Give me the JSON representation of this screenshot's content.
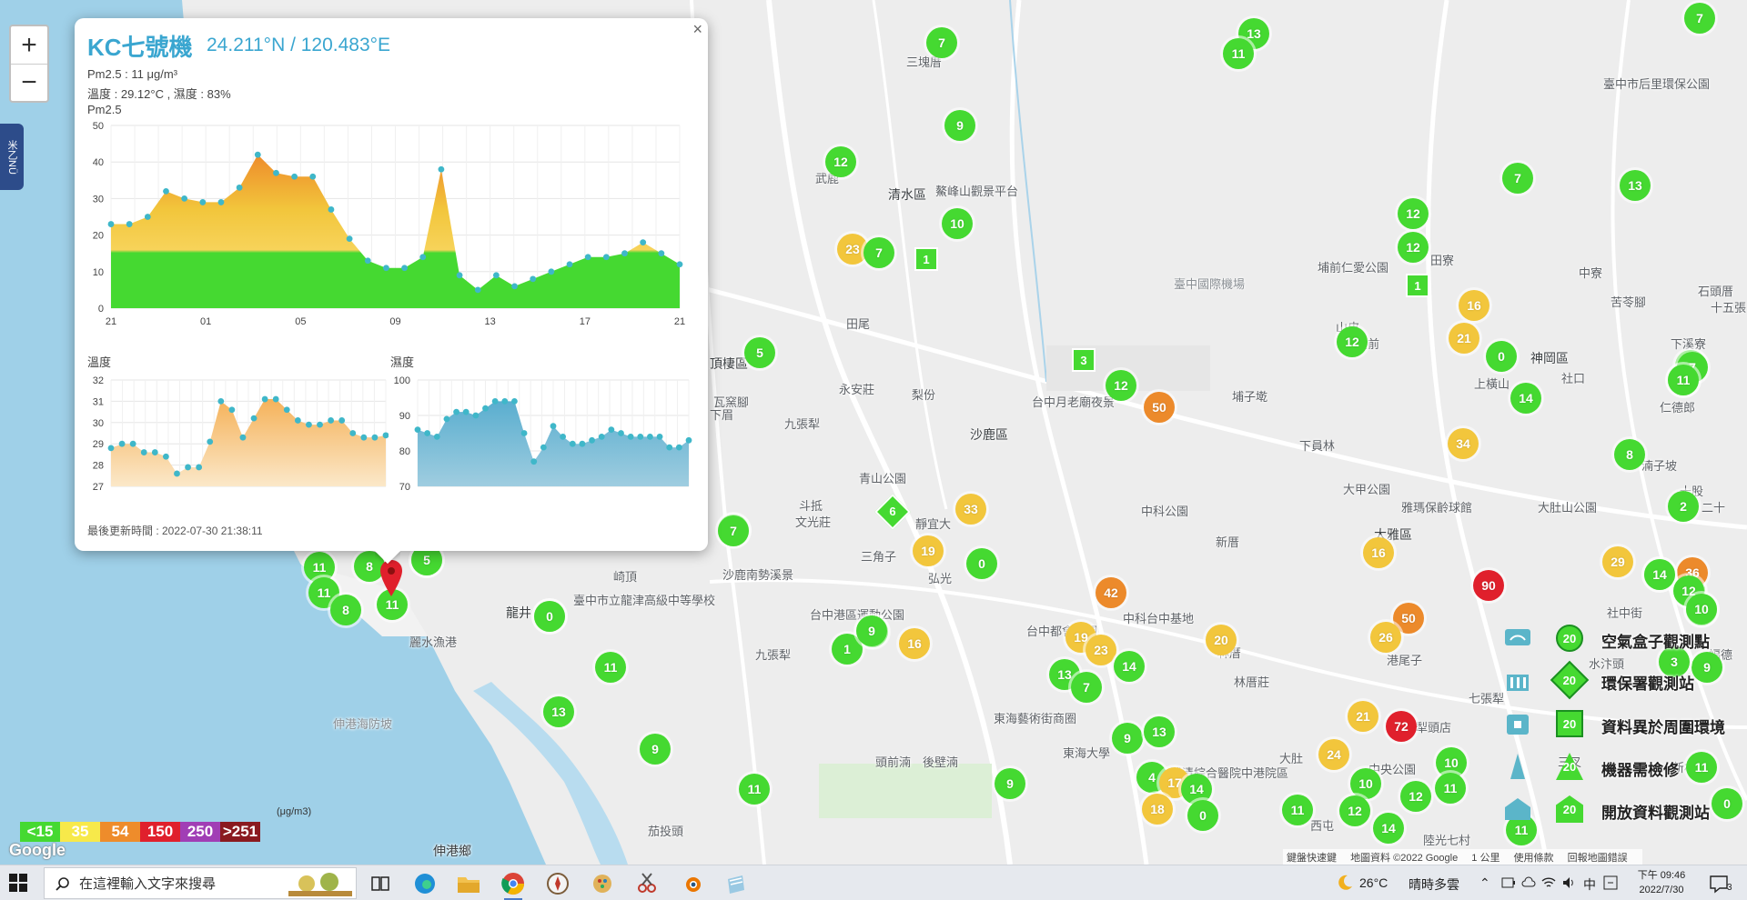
{
  "map": {
    "places": [
      "三塊厝",
      "臺中市后里環保公園",
      "武鹿",
      "清水區",
      "鰲峰山觀景平台",
      "臺中國際機場",
      "埔前仁愛公園",
      "田寮",
      "田尾",
      "山皮",
      "中寮",
      "苦苓腳",
      "石頭厝",
      "十五張",
      "莊前",
      "神岡區",
      "社口",
      "下溪寮",
      "永安莊",
      "梨份",
      "頂棲區",
      "沙鹿區",
      "台中月老廟夜景",
      "埔子墘",
      "下員林",
      "瓦窯腳",
      "下眉",
      "九張犁",
      "青山公園",
      "斗抵",
      "文光莊",
      "三角子",
      "靜宜大",
      "弘光",
      "大甲公園",
      "雅瑪保齡球館",
      "大肚山公園",
      "大雅區",
      "新厝",
      "中科公園",
      "湳子坡",
      "十股",
      "仁德郎",
      "二十",
      "上橫山",
      "崎頂",
      "臺中市立龍津高級中等學校",
      "龍井",
      "沙鹿南勢溪景",
      "台中港區運動公園",
      "中科台中基地",
      "林厝",
      "林厝莊",
      "港尾子",
      "麗水漁港",
      "台中都會公園",
      "九張犁",
      "東海藝術街商圈",
      "東海大學",
      "澄清綜合醫院中港院區",
      "中央公園",
      "西屯",
      "伸港海防坡",
      "伸港鄉",
      "茄投頭",
      "後壁湳",
      "頭前湳",
      "陸光七村",
      "大肚",
      "水汴頭",
      "七張犁",
      "犁頭店",
      "三叉",
      "社中街",
      "新村",
      "福德"
    ],
    "clusters": [
      {
        "v": "7",
        "c": "g"
      },
      {
        "v": "13",
        "c": "g"
      },
      {
        "v": "11",
        "c": "g"
      },
      {
        "v": "9",
        "c": "g"
      },
      {
        "v": "12",
        "c": "g"
      },
      {
        "v": "7",
        "c": "g"
      },
      {
        "v": "13",
        "c": "g"
      },
      {
        "v": "10",
        "c": "g"
      },
      {
        "v": "12",
        "c": "g"
      },
      {
        "v": "12",
        "c": "g"
      },
      {
        "v": "23",
        "c": "y"
      },
      {
        "v": "7",
        "c": "g"
      },
      {
        "v": "16",
        "c": "y"
      },
      {
        "v": "21",
        "c": "y"
      },
      {
        "v": "0",
        "c": "g"
      },
      {
        "v": "12",
        "c": "g"
      },
      {
        "v": "5",
        "c": "g"
      },
      {
        "v": "12",
        "c": "g"
      },
      {
        "v": "50",
        "c": "o"
      },
      {
        "v": "14",
        "c": "g"
      },
      {
        "v": "7",
        "c": "g"
      },
      {
        "v": "11",
        "c": "g"
      },
      {
        "v": "34",
        "c": "y"
      },
      {
        "v": "8",
        "c": "g"
      },
      {
        "v": "33",
        "c": "y"
      },
      {
        "v": "2",
        "c": "g"
      },
      {
        "v": "19",
        "c": "y"
      },
      {
        "v": "0",
        "c": "g"
      },
      {
        "v": "7",
        "c": "g"
      },
      {
        "v": "16",
        "c": "y"
      },
      {
        "v": "90",
        "c": "r"
      },
      {
        "v": "29",
        "c": "y"
      },
      {
        "v": "14",
        "c": "g"
      },
      {
        "v": "12",
        "c": "g"
      },
      {
        "v": "10",
        "c": "g"
      },
      {
        "v": "42",
        "c": "o"
      },
      {
        "v": "50",
        "c": "o"
      },
      {
        "v": "26",
        "c": "y"
      },
      {
        "v": "20",
        "c": "y"
      },
      {
        "v": "19",
        "c": "y"
      },
      {
        "v": "23",
        "c": "y"
      },
      {
        "v": "9",
        "c": "g"
      },
      {
        "v": "1",
        "c": "g"
      },
      {
        "v": "16",
        "c": "y"
      },
      {
        "v": "13",
        "c": "g"
      },
      {
        "v": "7",
        "c": "g"
      },
      {
        "v": "14",
        "c": "g"
      },
      {
        "v": "9",
        "c": "g"
      },
      {
        "v": "13",
        "c": "g"
      },
      {
        "v": "21",
        "c": "y"
      },
      {
        "v": "72",
        "c": "r"
      },
      {
        "v": "24",
        "c": "y"
      },
      {
        "v": "10",
        "c": "g"
      },
      {
        "v": "12",
        "c": "g"
      },
      {
        "v": "11",
        "c": "g"
      },
      {
        "v": "4",
        "c": "g"
      },
      {
        "v": "17",
        "c": "y"
      },
      {
        "v": "14",
        "c": "g"
      },
      {
        "v": "18",
        "c": "y"
      },
      {
        "v": "0",
        "c": "g"
      },
      {
        "v": "10",
        "c": "g"
      },
      {
        "v": "12",
        "c": "g"
      },
      {
        "v": "11",
        "c": "g"
      },
      {
        "v": "14",
        "c": "g"
      },
      {
        "v": "11",
        "c": "g"
      },
      {
        "v": "9",
        "c": "g"
      },
      {
        "v": "11",
        "c": "g"
      },
      {
        "v": "8",
        "c": "g"
      },
      {
        "v": "11",
        "c": "g"
      },
      {
        "v": "8",
        "c": "g"
      },
      {
        "v": "5",
        "c": "g"
      },
      {
        "v": "11",
        "c": "g"
      },
      {
        "v": "0",
        "c": "g"
      },
      {
        "v": "11",
        "c": "g"
      },
      {
        "v": "13",
        "c": "g"
      },
      {
        "v": "9",
        "c": "g"
      },
      {
        "v": "11",
        "c": "g"
      },
      {
        "v": "7",
        "c": "g"
      },
      {
        "v": "9",
        "c": "g"
      },
      {
        "v": "0",
        "c": "g"
      },
      {
        "v": "5",
        "c": "g"
      },
      {
        "v": "7",
        "c": "g"
      },
      {
        "v": "11",
        "c": "g"
      },
      {
        "v": "36",
        "c": "o"
      },
      {
        "v": "14",
        "c": "g"
      },
      {
        "v": "12",
        "c": "g"
      },
      {
        "v": "10",
        "c": "g"
      },
      {
        "v": "9",
        "c": "g"
      },
      {
        "v": "3",
        "c": "g"
      },
      {
        "v": "0",
        "c": "g"
      },
      {
        "v": "11",
        "c": "g"
      },
      {
        "v": "7",
        "c": "g"
      }
    ],
    "squares": [
      "1",
      "1",
      "3"
    ],
    "diamonds": [
      "6"
    ]
  },
  "popup": {
    "close": "×",
    "title": "KC七號機",
    "coords": "24.211°N / 120.483°E",
    "pm25": "Pm2.5 : 11 μg/m³",
    "temp_hum": "溫度 : 29.12°C , 濕度 : 83%",
    "chart_label": "Pm2.5",
    "temp_label": "溫度",
    "hum_label": "濕度",
    "updated": "最後更新時間 : 2022-07-30 21:38:11"
  },
  "chart_data": [
    {
      "type": "area",
      "title": "Pm2.5",
      "categories": [
        "21",
        "01",
        "05",
        "09",
        "13",
        "17",
        "21"
      ],
      "ylim": [
        0,
        50
      ],
      "yticks": [
        0,
        10,
        20,
        30,
        40,
        50
      ],
      "values": [
        23,
        23,
        25,
        32,
        30,
        29,
        29,
        33,
        42,
        37,
        36,
        36,
        27,
        19,
        13,
        11,
        11,
        14,
        38,
        9,
        5,
        9,
        6,
        8,
        10,
        12,
        14,
        14,
        15,
        18,
        15,
        12
      ]
    },
    {
      "type": "area",
      "title": "溫度",
      "ylim": [
        27,
        32
      ],
      "yticks": [
        27,
        28,
        29,
        30,
        31,
        32
      ],
      "values": [
        28.8,
        29.0,
        29.0,
        28.6,
        28.6,
        28.4,
        27.6,
        27.9,
        27.9,
        29.1,
        31.0,
        30.6,
        29.3,
        30.2,
        31.1,
        31.1,
        30.6,
        30.1,
        29.9,
        29.9,
        30.1,
        30.1,
        29.5,
        29.3,
        29.3,
        29.4
      ]
    },
    {
      "type": "area",
      "title": "濕度",
      "ylim": [
        70,
        100
      ],
      "yticks": [
        70,
        80,
        90,
        100
      ],
      "values": [
        86,
        85,
        84,
        89,
        91,
        91,
        90,
        92,
        94,
        94,
        94,
        85,
        77,
        81,
        87,
        84,
        82,
        82,
        83,
        84,
        86,
        85,
        84,
        84,
        84,
        84,
        81,
        81,
        83
      ]
    }
  ],
  "scale": {
    "unit": "(μg/m3)",
    "bands": [
      {
        "label": "<15",
        "color": "#45d931"
      },
      {
        "label": "35",
        "color": "#f7e94a"
      },
      {
        "label": "54",
        "color": "#ee8c2b"
      },
      {
        "label": "150",
        "color": "#e0202c"
      },
      {
        "label": "250",
        "color": "#a13eb5"
      },
      {
        "label": ">251",
        "color": "#8a1a1f"
      }
    ]
  },
  "legend": {
    "rows": [
      {
        "label": "空氣盒子觀測點",
        "marker": "20",
        "shape": "circle"
      },
      {
        "label": "環保署觀測站",
        "marker": "20",
        "shape": "diamond"
      },
      {
        "label": "資料異於周圍環境",
        "marker": "20",
        "shape": "square"
      },
      {
        "label": "機器需檢修",
        "marker": "20",
        "shape": "triangle"
      },
      {
        "label": "開放資料觀測站",
        "marker": "20",
        "shape": "house"
      }
    ]
  },
  "side_tab": "米乙NÜ",
  "google": "Google",
  "attribution": {
    "shortcuts": "鍵盤快速鍵",
    "mapdata": "地圖資料 ©2022 Google",
    "scale": "1 公里",
    "terms": "使用條款",
    "report": "回報地圖錯誤"
  },
  "zoom": {
    "plus": "+",
    "minus": "−"
  },
  "taskbar": {
    "search_placeholder": "在這裡輸入文字來搜尋",
    "weather_temp": "26°C",
    "weather_text": "晴時多雲",
    "ime": "中",
    "clock_time": "下午 09:46",
    "clock_date": "2022/7/30",
    "notif_count": "3"
  }
}
